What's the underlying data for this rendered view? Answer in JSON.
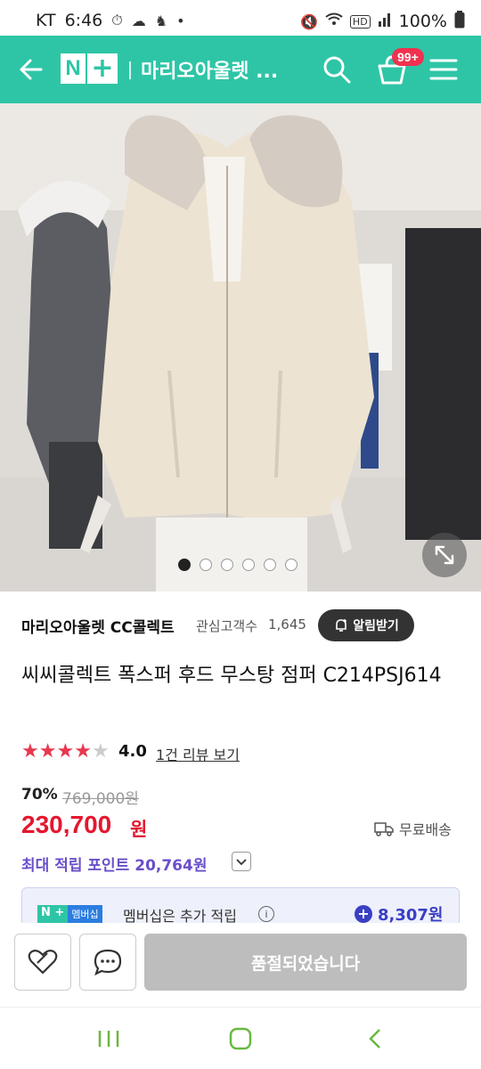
{
  "status_bar": {
    "carrier": "KT",
    "time": "6:46",
    "battery": "100%"
  },
  "header": {
    "logo_n": "N",
    "logo_plus": "+",
    "title": "마리오아울렛 ...",
    "cart_badge": "99+",
    "accent_color": "#2ec5a6"
  },
  "gallery": {
    "slide_count": 6,
    "active_slide": 1
  },
  "seller": {
    "name": "마리오아울렛 CC콜렉트",
    "fav_label": "관심고객수",
    "fav_count": "1,645",
    "alarm_label": "알림받기"
  },
  "product": {
    "name": "씨씨콜렉트 폭스퍼 후드 무스탕 점퍼 C214PSJ614",
    "rating": 4.0,
    "rating_text": "4.0",
    "review_link": "1건 리뷰 보기",
    "discount": "70%",
    "original_price": "769,000원",
    "sale_price": "230,700",
    "currency": "원",
    "shipping": "무료배송",
    "points": "최대 적립 포인트 20,764원"
  },
  "membership": {
    "badge_n": "N +",
    "badge_label": "멤버십",
    "text": "멤버십은 추가 적립",
    "info": "i",
    "amount": "8,307원"
  },
  "actions": {
    "soldout_label": "품절되었습니다"
  }
}
